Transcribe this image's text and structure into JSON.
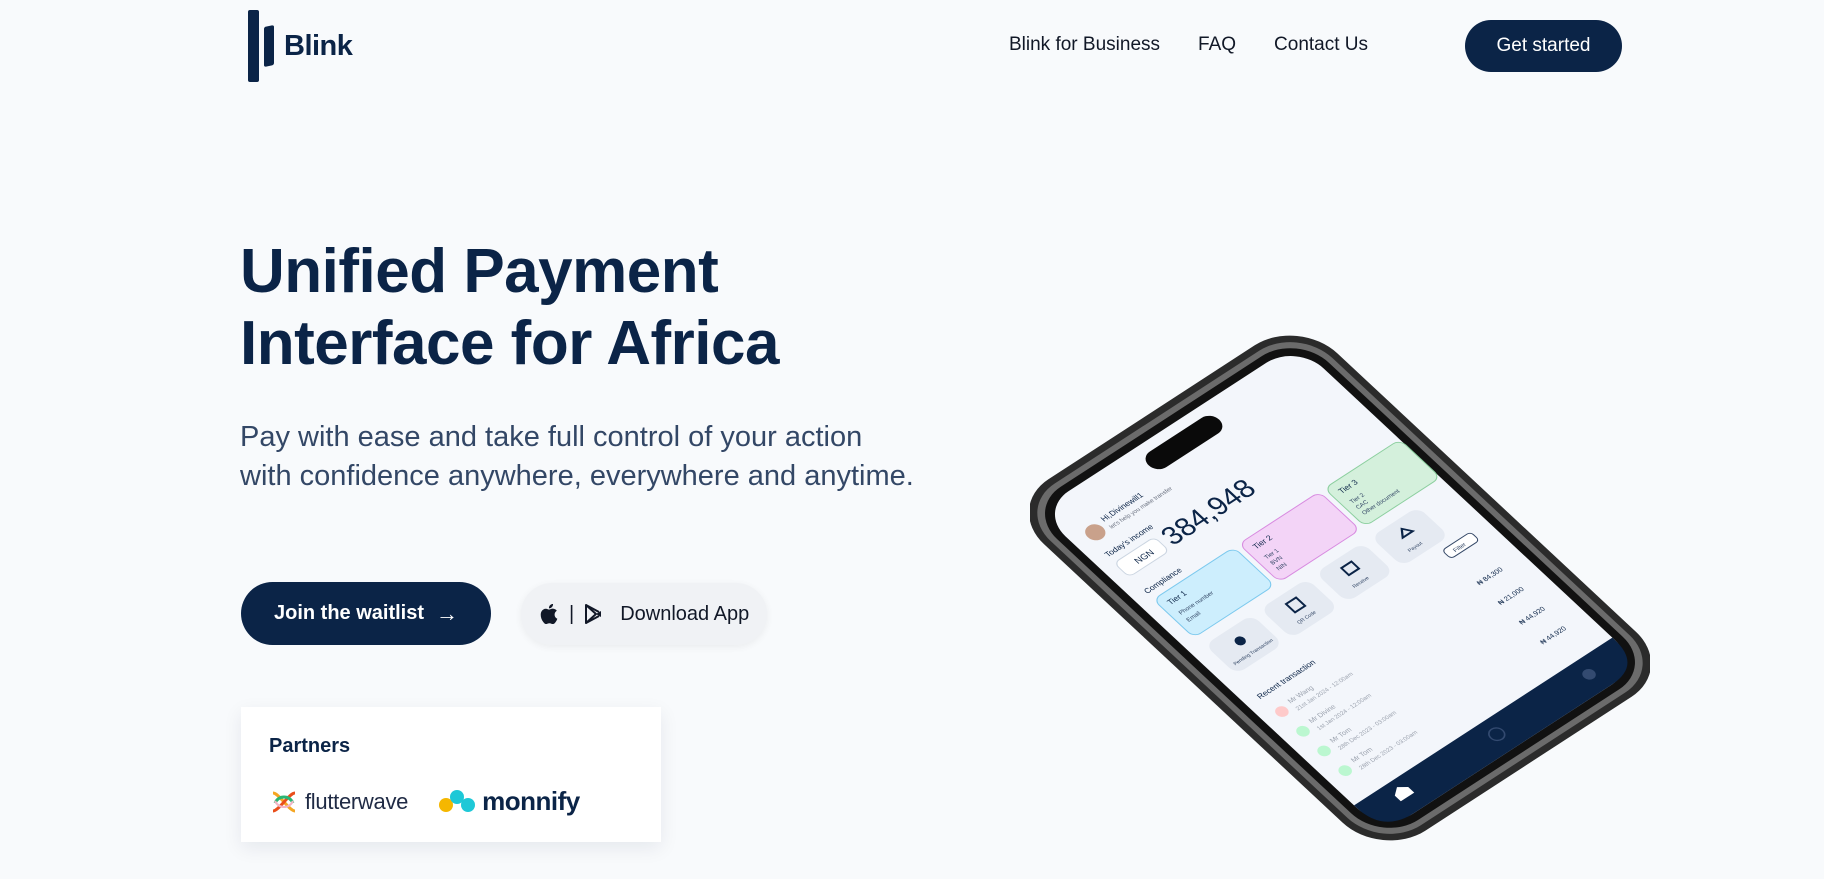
{
  "brand": {
    "name": "Blink"
  },
  "nav": {
    "links": [
      "Blink for Business",
      "FAQ",
      "Contact Us"
    ],
    "cta_label": "Get started"
  },
  "hero": {
    "title_line1": "Unified Payment",
    "title_line2": "Interface for Africa",
    "subtitle": "Pay with ease and take full control of your action with confidence anywhere, everywhere and anytime.",
    "waitlist_label": "Join the waitlist",
    "download_label": "Download App",
    "download_separator": "|"
  },
  "partners": {
    "title": "Partners",
    "logos": [
      "flutterwave",
      "monnify"
    ]
  },
  "phone": {
    "greeting": "Hi,Divinewill1",
    "tagline": "let's help you make transfer",
    "income_label": "Today's income",
    "currency": "NGN",
    "balance": "384,948",
    "compliance_label": "Compliance",
    "tiers": [
      {
        "name": "Tier 1",
        "items": [
          "Phone number",
          "Email"
        ]
      },
      {
        "name": "Tier 2",
        "items": [
          "Tier 1",
          "BVN",
          "NIN"
        ]
      },
      {
        "name": "Tier 3",
        "items": [
          "Tier 2",
          "CAC",
          "Other document"
        ]
      }
    ],
    "actions": [
      "Pending Transaction",
      "QR Code",
      "Receive",
      "Payout"
    ],
    "filter_label": "Filter",
    "recent_label": "Recent transaction",
    "transactions": [
      {
        "name": "Mr Wang",
        "date": "21st Jan 2024 - 12:00am",
        "amount": "₦ 84,300"
      },
      {
        "name": "Mr Divine",
        "date": "1st Jan 2024 - 12:00am",
        "amount": "₦ 21,000"
      },
      {
        "name": "Mr Tom",
        "date": "28th Dec 2023 - 03:00am",
        "amount": "₦ 44,920"
      },
      {
        "name": "Mr Tom",
        "date": "28th Dec 2023 - 03:00am",
        "amount": "₦ 44,920"
      }
    ]
  },
  "colors": {
    "primary": "#0b2447",
    "background": "#f8fafc",
    "tier1": "#cdeefd",
    "tier2": "#f3d4f7",
    "tier3": "#d4f0dc"
  }
}
